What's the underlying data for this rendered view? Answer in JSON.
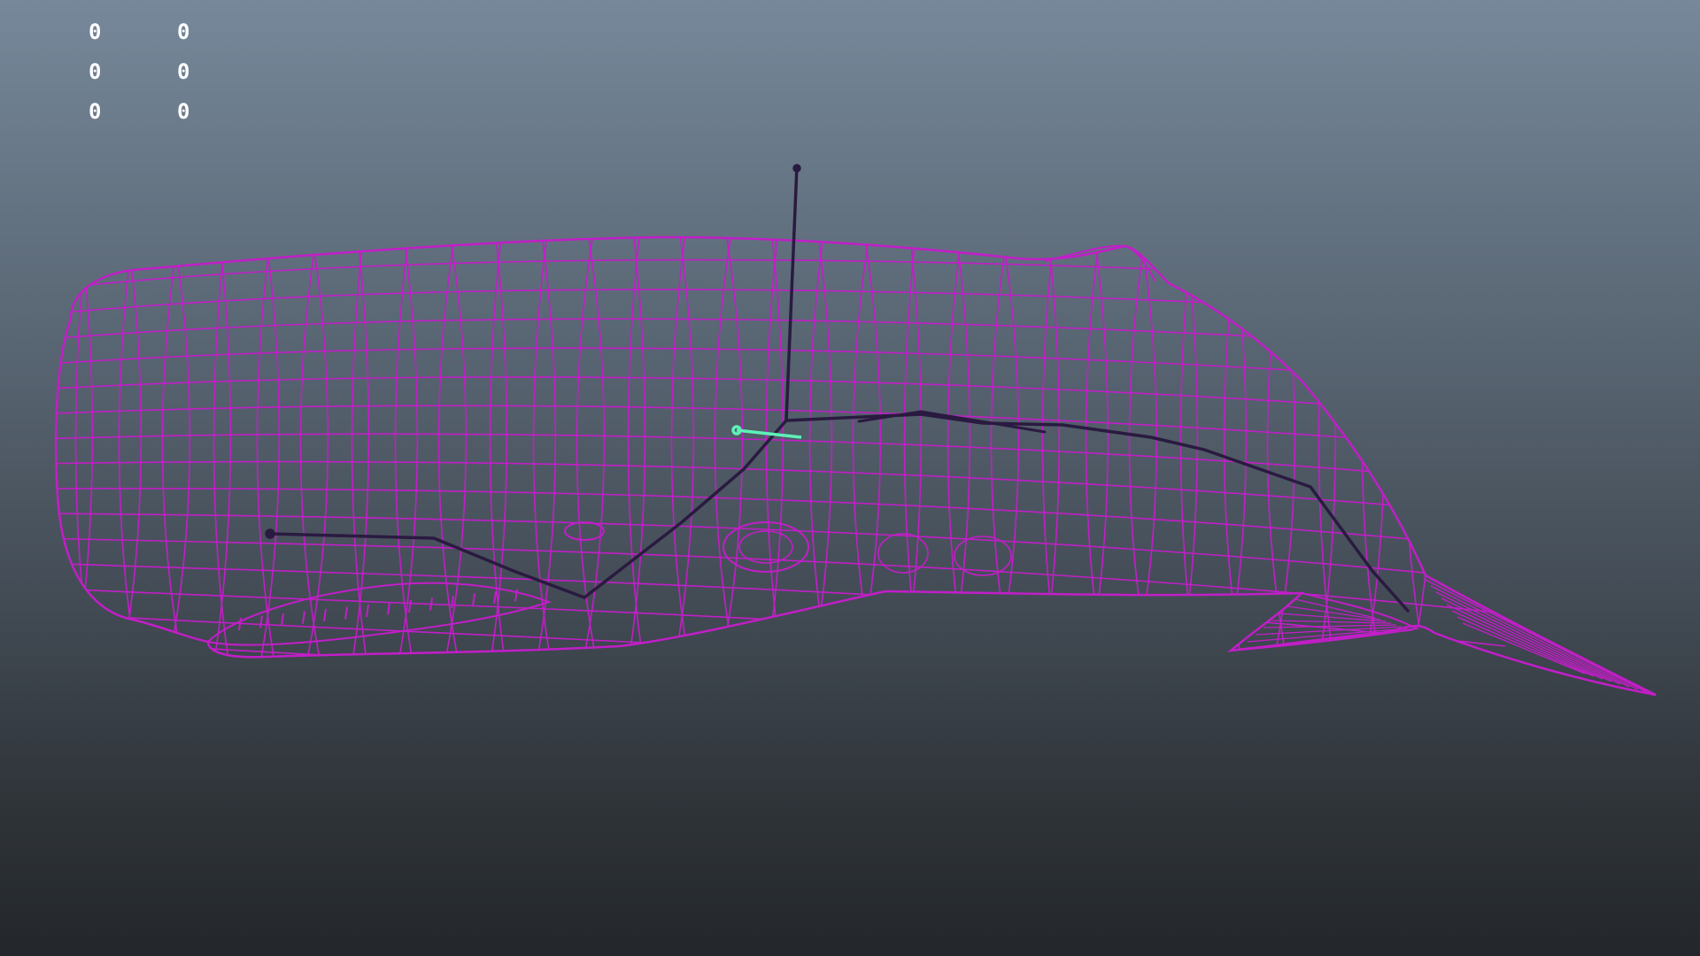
{
  "viewport": {
    "background_top": "#76889a",
    "background_bottom": "#23272b"
  },
  "hud": {
    "rows": [
      {
        "a": "0",
        "b": "0"
      },
      {
        "a": "0",
        "b": "0"
      },
      {
        "a": "0",
        "b": "0"
      }
    ]
  },
  "scene": {
    "wireframe_color": "#c21ec8",
    "skeleton_color": "#2a1a40",
    "selected_joint_color": "#5ff0b8",
    "objects": [
      "whale-mesh-wireframe",
      "skeleton-joints",
      "pivot-axis"
    ]
  }
}
